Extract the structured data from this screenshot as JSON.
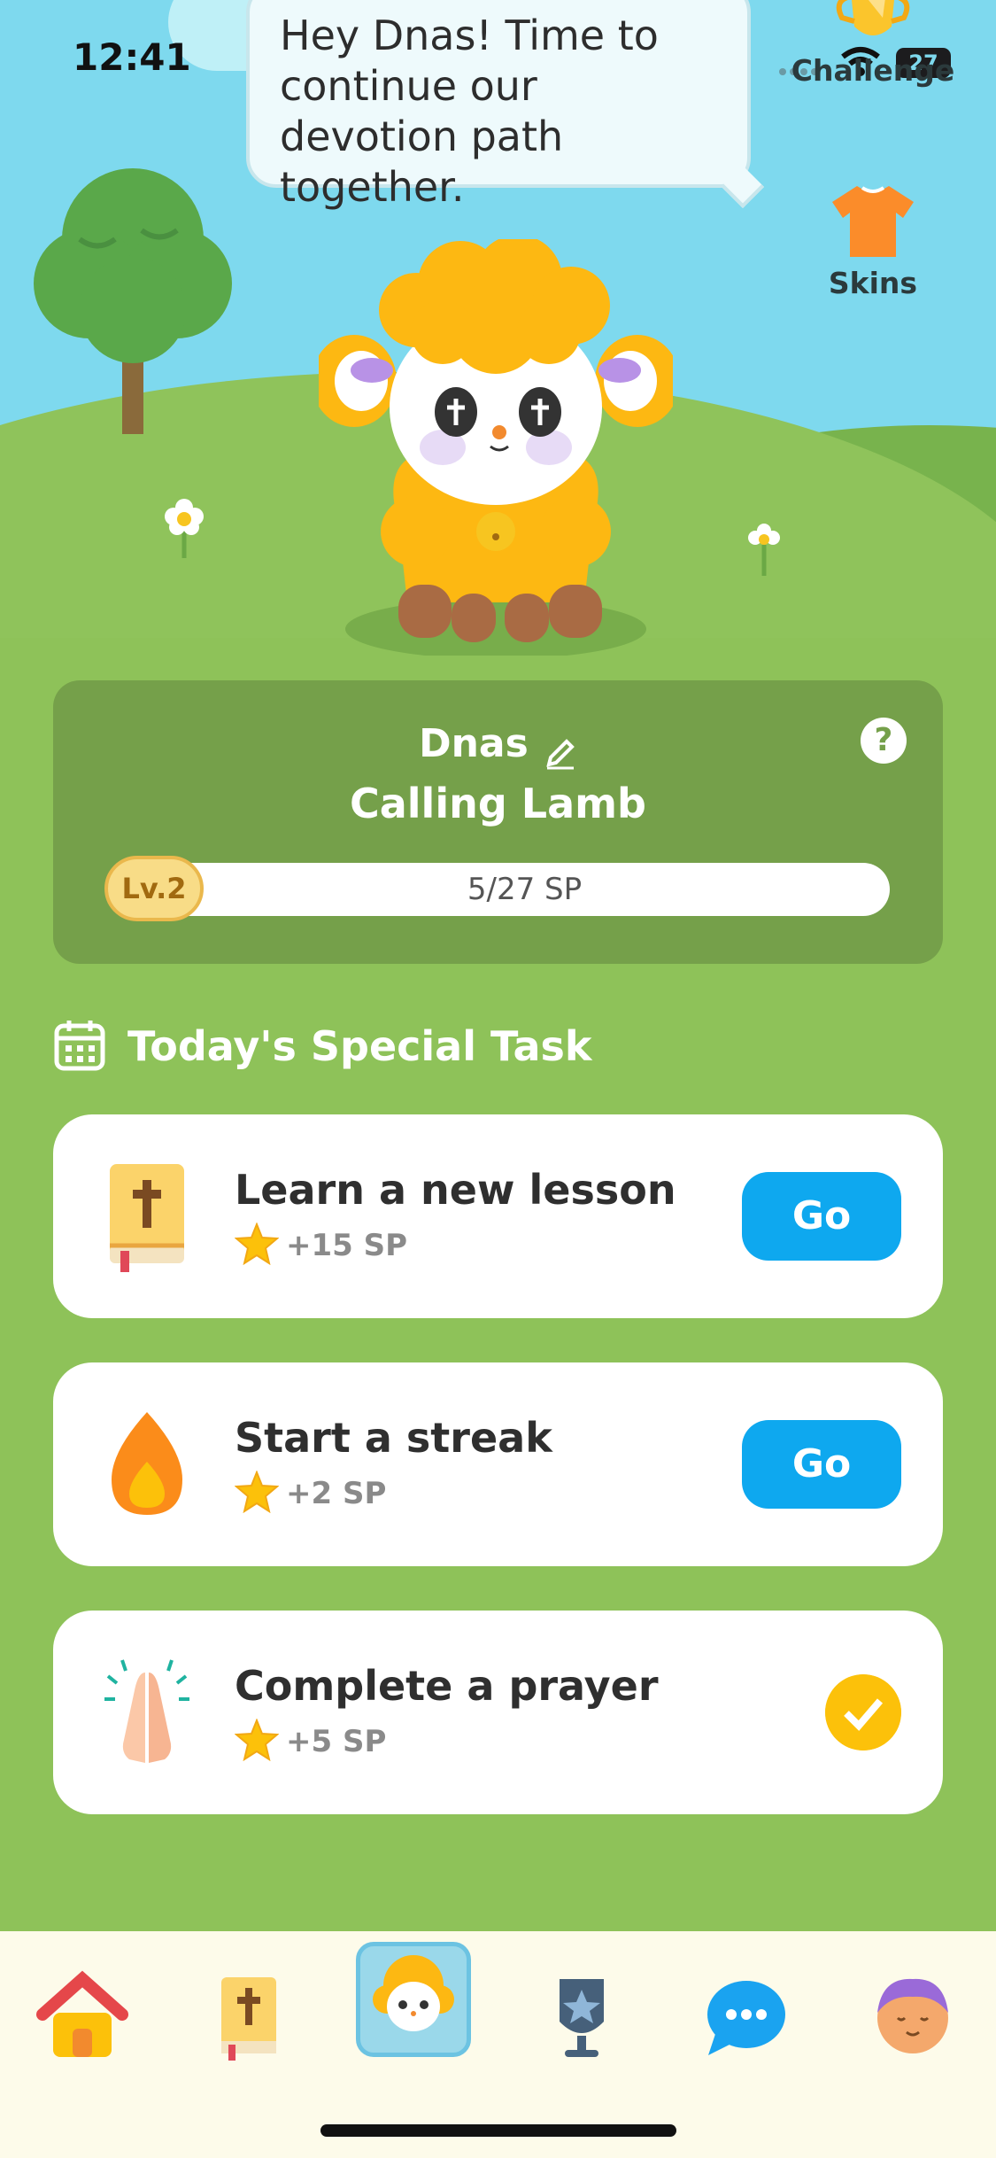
{
  "status_bar": {
    "time": "12:41",
    "battery": "27"
  },
  "speech_bubble": {
    "text": "Hey Dnas! Time to continue our devotion path together."
  },
  "side_buttons": {
    "challenge_label": "Challenge",
    "skins_label": "Skins"
  },
  "pet": {
    "name": "Dnas",
    "title": "Calling Lamb",
    "level": "Lv.2",
    "progress_text": "5/27 SP",
    "progress_fraction": 0.185
  },
  "section": {
    "title": "Today's Special Task"
  },
  "tasks": [
    {
      "title": "Learn a new lesson",
      "reward": "+15 SP",
      "action": "Go",
      "icon": "bible-icon",
      "completed": false
    },
    {
      "title": "Start a streak",
      "reward": "+2 SP",
      "action": "Go",
      "icon": "flame-icon",
      "completed": false
    },
    {
      "title": "Complete a prayer",
      "reward": "+5 SP",
      "action": "",
      "icon": "praying-hands-icon",
      "completed": true
    }
  ],
  "bottom_nav": [
    {
      "icon": "home-icon",
      "active": false
    },
    {
      "icon": "bible-icon",
      "active": false
    },
    {
      "icon": "lamb-icon",
      "active": true
    },
    {
      "icon": "trophy-badge-icon",
      "active": false
    },
    {
      "icon": "chat-icon",
      "active": false
    },
    {
      "icon": "profile-avatar-icon",
      "active": false
    }
  ],
  "colors": {
    "sky": "#7ed9ee",
    "grass": "#8ec259",
    "card": "#75a04a",
    "go_button": "#0ea8ef",
    "check": "#fcc10a",
    "lamb_wool": "#fdb812"
  }
}
